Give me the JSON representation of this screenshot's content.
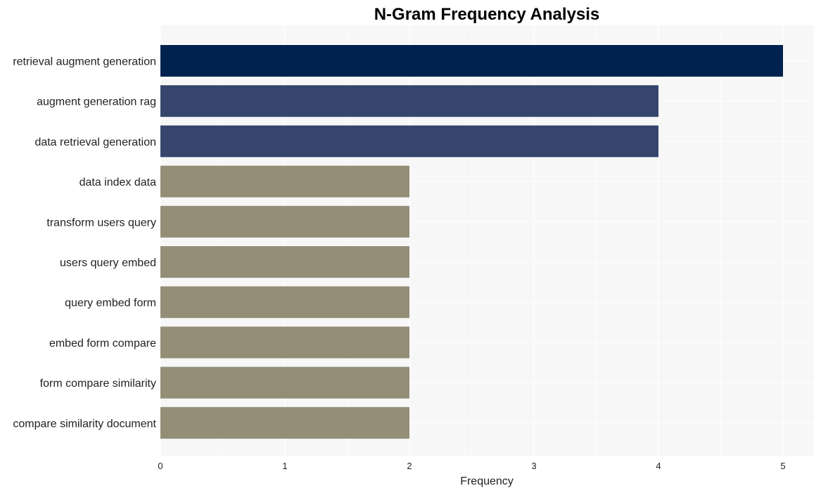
{
  "chart_data": {
    "type": "bar",
    "orientation": "horizontal",
    "title": "N-Gram Frequency Analysis",
    "xlabel": "Frequency",
    "ylabel": "",
    "xlim": [
      0,
      5.25
    ],
    "xticks": [
      0,
      1,
      2,
      3,
      4,
      5
    ],
    "grid": true,
    "legend": "none",
    "categories": [
      "retrieval augment generation",
      "augment generation rag",
      "data retrieval generation",
      "data index data",
      "transform users query",
      "users query embed",
      "query embed form",
      "embed form compare",
      "form compare similarity",
      "compare similarity document"
    ],
    "values": [
      5,
      4,
      4,
      2,
      2,
      2,
      2,
      2,
      2,
      2
    ],
    "colors": [
      "#00224e",
      "#35456c",
      "#35456c",
      "#948e77",
      "#948e77",
      "#948e77",
      "#948e77",
      "#948e77",
      "#948e77",
      "#948e77"
    ],
    "background_color": "#f7f7f7",
    "grid_color": "#ffffff"
  }
}
